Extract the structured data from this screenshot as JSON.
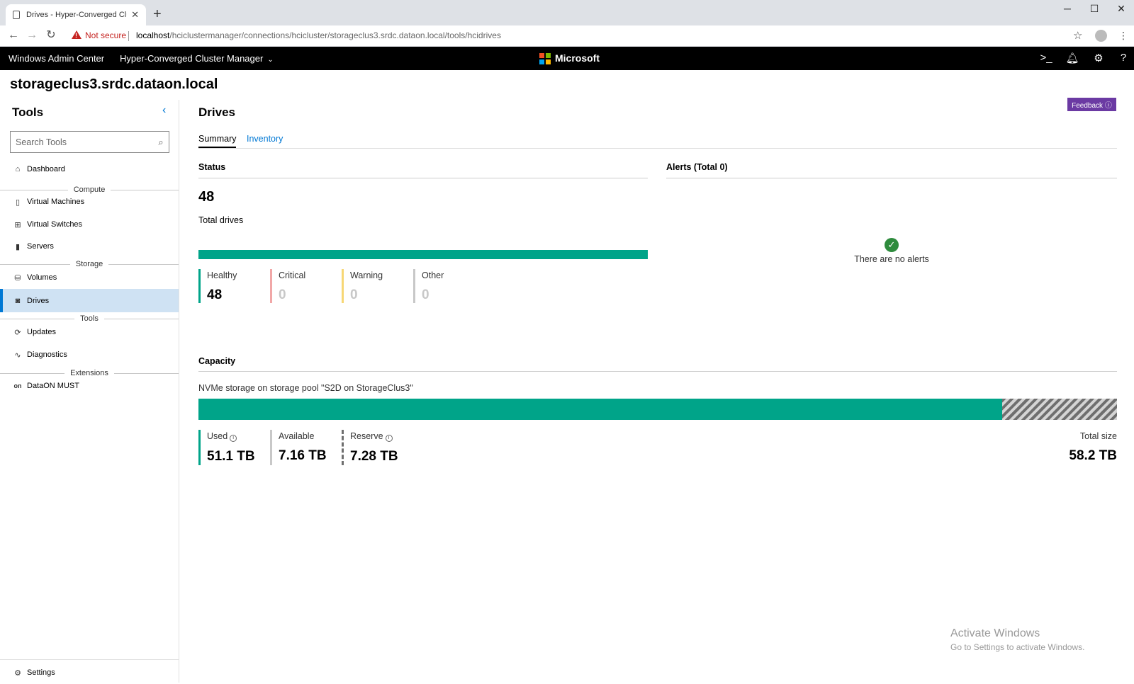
{
  "browser": {
    "tab_title": "Drives - Hyper-Converged Cluste",
    "security": "Not secure",
    "url_host": "localhost",
    "url_path": "/hciclustermanager/connections/hcicluster/storageclus3.srdc.dataon.local/tools/hcidrives"
  },
  "app": {
    "name": "Windows Admin Center",
    "connection_type": "Hyper-Converged Cluster Manager",
    "brand": "Microsoft",
    "connection_name": "storageclus3.srdc.dataon.local"
  },
  "sidebar": {
    "title": "Tools",
    "search_placeholder": "Search Tools",
    "items": [
      {
        "label": "Dashboard",
        "icon": "home-icon"
      },
      {
        "group": "Compute"
      },
      {
        "label": "Virtual Machines",
        "icon": "vm-icon"
      },
      {
        "label": "Virtual Switches",
        "icon": "switch-icon"
      },
      {
        "label": "Servers",
        "icon": "server-icon"
      },
      {
        "group": "Storage"
      },
      {
        "label": "Volumes",
        "icon": "volume-icon"
      },
      {
        "label": "Drives",
        "icon": "drive-icon",
        "active": true
      },
      {
        "group": "Tools"
      },
      {
        "label": "Updates",
        "icon": "update-icon"
      },
      {
        "label": "Diagnostics",
        "icon": "stethoscope-icon"
      },
      {
        "group": "Extensions"
      },
      {
        "label": "DataON MUST",
        "icon": "dataon-icon"
      }
    ],
    "settings_label": "Settings"
  },
  "main": {
    "title": "Drives",
    "feedback_label": "Feedback ⓘ",
    "tabs": [
      "Summary",
      "Inventory"
    ],
    "status": {
      "heading": "Status",
      "total": "48",
      "total_label": "Total drives",
      "breakdown": [
        {
          "label": "Healthy",
          "value": "48",
          "color": "#00a489"
        },
        {
          "label": "Critical",
          "value": "0",
          "color": "#f1a7a7"
        },
        {
          "label": "Warning",
          "value": "0",
          "color": "#f7d775"
        },
        {
          "label": "Other",
          "value": "0",
          "color": "#c8c8c8"
        }
      ]
    },
    "alerts": {
      "heading": "Alerts (Total 0)",
      "empty_text": "There are no alerts"
    },
    "capacity": {
      "heading": "Capacity",
      "pool_label": "NVMe storage on storage pool \"S2D on StorageClus3\"",
      "used_label": "Used",
      "used_value": "51.1 TB",
      "available_label": "Available",
      "available_value": "7.16 TB",
      "reserve_label": "Reserve",
      "reserve_value": "7.28 TB",
      "total_label": "Total size",
      "total_value": "58.2 TB",
      "reserve_fraction": 0.125
    }
  },
  "watermark": {
    "line1": "Activate Windows",
    "line2": "Go to Settings to activate Windows."
  }
}
